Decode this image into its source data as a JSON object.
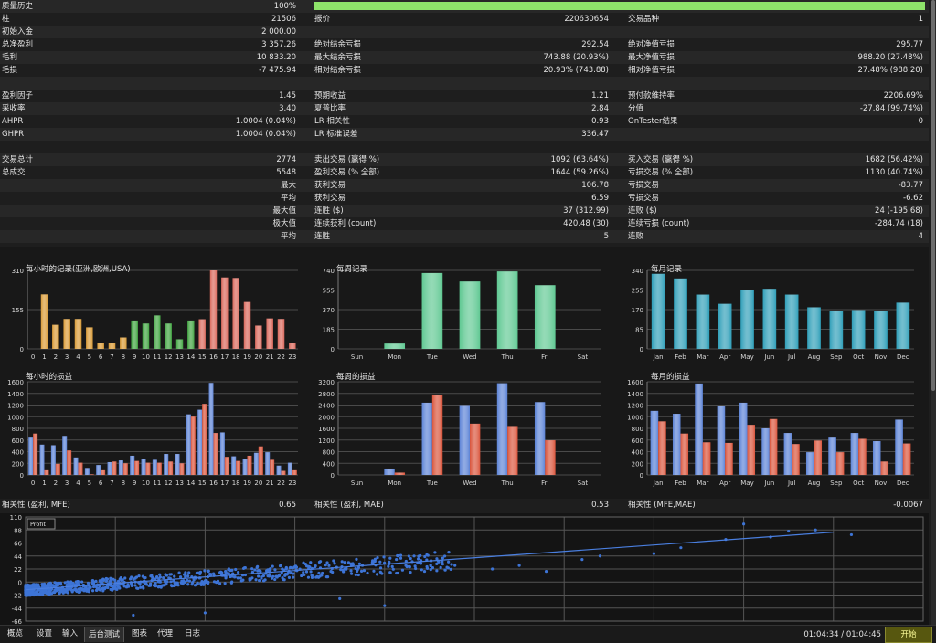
{
  "progress": {
    "label": "质量历史",
    "value": "100%",
    "fraction": 1.0
  },
  "stats_rows": [
    [
      {
        "l": "柱",
        "v": "21506"
      },
      {
        "l": "报价",
        "v": "220630654"
      },
      {
        "l": "交易品种",
        "v": "1"
      }
    ],
    [
      {
        "l": "初始入金",
        "v": "2 000.00"
      },
      {
        "l": "",
        "v": ""
      },
      {
        "l": "",
        "v": ""
      }
    ],
    [
      {
        "l": "总净盈利",
        "v": "3 357.26"
      },
      {
        "l": "绝对结余亏损",
        "v": "292.54"
      },
      {
        "l": "绝对净值亏损",
        "v": "295.77"
      }
    ],
    [
      {
        "l": "毛利",
        "v": "10 833.20"
      },
      {
        "l": "最大结余亏损",
        "v": "743.88 (20.93%)"
      },
      {
        "l": "最大净值亏损",
        "v": "988.20 (27.48%)"
      }
    ],
    [
      {
        "l": "毛损",
        "v": "-7 475.94"
      },
      {
        "l": "相对结余亏损",
        "v": "20.93% (743.88)"
      },
      {
        "l": "相对净值亏损",
        "v": "27.48% (988.20)"
      }
    ],
    [
      {
        "l": "",
        "v": ""
      },
      {
        "l": "",
        "v": ""
      },
      {
        "l": "",
        "v": ""
      }
    ],
    [
      {
        "l": "盈利因子",
        "v": "1.45"
      },
      {
        "l": "预期收益",
        "v": "1.21"
      },
      {
        "l": "预付款维持率",
        "v": "2206.69%"
      }
    ],
    [
      {
        "l": "采收率",
        "v": "3.40"
      },
      {
        "l": "夏普比率",
        "v": "2.84"
      },
      {
        "l": "分值",
        "v": "-27.84 (99.74%)"
      }
    ],
    [
      {
        "l": "AHPR",
        "v": "1.0004 (0.04%)"
      },
      {
        "l": "LR 相关性",
        "v": "0.93"
      },
      {
        "l": "OnTester结果",
        "v": "0"
      }
    ],
    [
      {
        "l": "GHPR",
        "v": "1.0004 (0.04%)"
      },
      {
        "l": "LR 标准误差",
        "v": "336.47"
      },
      {
        "l": "",
        "v": ""
      }
    ],
    [
      {
        "l": "",
        "v": ""
      },
      {
        "l": "",
        "v": ""
      },
      {
        "l": "",
        "v": ""
      }
    ],
    [
      {
        "l": "交易总计",
        "v": "2774"
      },
      {
        "l": "卖出交易 (赢得 %)",
        "v": "1092 (63.64%)"
      },
      {
        "l": "买入交易 (赢得 %)",
        "v": "1682 (56.42%)"
      }
    ],
    [
      {
        "l": "总成交",
        "v": "5548"
      },
      {
        "l": "盈利交易 (% 全部)",
        "v": "1644 (59.26%)"
      },
      {
        "l": "亏损交易 (% 全部)",
        "v": "1130 (40.74%)"
      }
    ],
    [
      {
        "l": "最大",
        "v": "",
        "r": true
      },
      {
        "l": "获利交易",
        "v": "106.78"
      },
      {
        "l": "亏损交易",
        "v": "-83.77"
      }
    ],
    [
      {
        "l": "平均",
        "v": "",
        "r": true
      },
      {
        "l": "获利交易",
        "v": "6.59"
      },
      {
        "l": "亏损交易",
        "v": "-6.62"
      }
    ],
    [
      {
        "l": "最大值",
        "v": "",
        "r": true
      },
      {
        "l": "连胜 ($)",
        "v": "37 (312.99)"
      },
      {
        "l": "连败 ($)",
        "v": "24 (-195.68)"
      }
    ],
    [
      {
        "l": "极大值",
        "v": "",
        "r": true
      },
      {
        "l": "连续获利 (count)",
        "v": "420.48 (30)"
      },
      {
        "l": "连续亏损 (count)",
        "v": "-284.74 (18)"
      }
    ],
    [
      {
        "l": "平均",
        "v": "",
        "r": true
      },
      {
        "l": "连胜",
        "v": "5"
      },
      {
        "l": "连败",
        "v": "4"
      }
    ]
  ],
  "correlations": [
    {
      "l": "相关性 (盈利, MFE)",
      "v": "0.65"
    },
    {
      "l": "相关性 (盈利, MAE)",
      "v": "0.53"
    },
    {
      "l": "相关性 (MFE,MAE)",
      "v": "-0.0067"
    }
  ],
  "colors": {
    "hour_am": "#d99a35",
    "hour_mid": "#3fa33f",
    "hour_pm": "#d9675a",
    "week": "#5fc892",
    "month": "#2e9eb8",
    "profit": "#5b82d6",
    "loss": "#d9533a",
    "progress": "#8ee36a",
    "scatter": "#3d74d6"
  },
  "chart_data": [
    {
      "id": "hourly_trades",
      "type": "bar",
      "title": "每小时的记录(亚洲,欧洲,USA)",
      "categories": [
        "0",
        "1",
        "2",
        "3",
        "4",
        "5",
        "6",
        "7",
        "8",
        "9",
        "10",
        "11",
        "12",
        "13",
        "14",
        "15",
        "16",
        "17",
        "18",
        "19",
        "20",
        "21",
        "22",
        "23"
      ],
      "values": [
        0,
        215,
        95,
        118,
        118,
        85,
        25,
        25,
        45,
        112,
        100,
        132,
        100,
        38,
        112,
        117,
        310,
        282,
        280,
        185,
        92,
        120,
        118,
        25
      ],
      "ylim": [
        0,
        310
      ],
      "yticks": [
        0,
        155,
        310
      ]
    },
    {
      "id": "weekly_trades",
      "type": "bar",
      "title": "每周记录",
      "categories": [
        "Sun",
        "Mon",
        "Tue",
        "Wed",
        "Thu",
        "Fri",
        "Sat"
      ],
      "values": [
        0,
        50,
        715,
        635,
        730,
        600,
        0
      ],
      "ylim": [
        0,
        740
      ],
      "yticks": [
        0,
        185,
        370,
        555,
        740
      ]
    },
    {
      "id": "monthly_trades",
      "type": "bar",
      "title": "每月记录",
      "categories": [
        "Jan",
        "Feb",
        "Mar",
        "Apr",
        "May",
        "Jun",
        "Jul",
        "Aug",
        "Sep",
        "Oct",
        "Nov",
        "Dec"
      ],
      "values": [
        325,
        305,
        235,
        195,
        255,
        260,
        235,
        180,
        165,
        168,
        163,
        200
      ],
      "ylim": [
        0,
        340
      ],
      "yticks": [
        0,
        85,
        170,
        255,
        340
      ]
    },
    {
      "id": "hourly_pl",
      "type": "bar",
      "title": "每小时的损益",
      "categories": [
        "0",
        "1",
        "2",
        "3",
        "4",
        "5",
        "6",
        "7",
        "8",
        "9",
        "10",
        "11",
        "12",
        "13",
        "14",
        "15",
        "16",
        "17",
        "18",
        "19",
        "20",
        "21",
        "22",
        "23"
      ],
      "series": [
        {
          "name": "profit",
          "values": [
            640,
            520,
            510,
            670,
            300,
            120,
            170,
            220,
            250,
            330,
            280,
            260,
            360,
            360,
            1040,
            1120,
            1580,
            730,
            320,
            280,
            380,
            390,
            160,
            210
          ]
        },
        {
          "name": "loss",
          "values": [
            710,
            80,
            190,
            420,
            210,
            10,
            80,
            230,
            200,
            240,
            210,
            210,
            230,
            200,
            1000,
            1220,
            720,
            310,
            240,
            330,
            490,
            260,
            70,
            80
          ]
        }
      ],
      "ylim": [
        0,
        1600
      ],
      "yticks": [
        0,
        200,
        400,
        600,
        800,
        1000,
        1200,
        1400,
        1600
      ]
    },
    {
      "id": "weekly_pl",
      "type": "bar",
      "title": "每周的损益",
      "categories": [
        "Sun",
        "Mon",
        "Tue",
        "Wed",
        "Thu",
        "Fri",
        "Sat"
      ],
      "series": [
        {
          "name": "profit",
          "values": [
            0,
            220,
            2480,
            2400,
            3150,
            2500,
            0
          ]
        },
        {
          "name": "loss",
          "values": [
            0,
            80,
            2760,
            1760,
            1680,
            1190,
            0
          ]
        }
      ],
      "ylim": [
        0,
        3200
      ],
      "yticks": [
        0,
        400,
        800,
        1200,
        1600,
        2000,
        2400,
        2800,
        3200
      ]
    },
    {
      "id": "monthly_pl",
      "type": "bar",
      "title": "每月的损益",
      "categories": [
        "Jan",
        "Feb",
        "Mar",
        "Apr",
        "May",
        "Jun",
        "Jul",
        "Aug",
        "Sep",
        "Oct",
        "Nov",
        "Dec"
      ],
      "series": [
        {
          "name": "profit",
          "values": [
            1100,
            1050,
            1570,
            1190,
            1240,
            800,
            720,
            390,
            640,
            720,
            580,
            950
          ]
        },
        {
          "name": "loss",
          "values": [
            920,
            710,
            560,
            550,
            860,
            960,
            530,
            590,
            390,
            620,
            230,
            540
          ]
        }
      ],
      "ylim": [
        0,
        1600
      ],
      "yticks": [
        0,
        200,
        400,
        600,
        800,
        1000,
        1200,
        1400,
        1600
      ]
    },
    {
      "id": "profit_scatter",
      "type": "scatter",
      "legend": "Profit",
      "ylim": [
        -66,
        110
      ],
      "yticks": [
        110,
        88,
        66,
        44,
        22,
        0,
        -22,
        -44,
        -66
      ],
      "trend": {
        "x0": 0,
        "y0": -13,
        "x1": 100,
        "y1": 95
      }
    }
  ],
  "tabs": [
    "概览",
    "设置",
    "输入",
    "后台测试",
    "图表",
    "代理",
    "日志"
  ],
  "active_tab": "后台测试",
  "time_display": "01:04:34 / 01:04:45",
  "start_button": "开始"
}
